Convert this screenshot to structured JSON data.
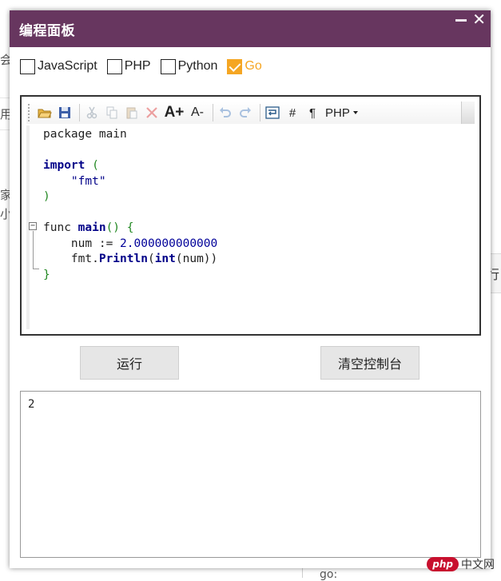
{
  "background": {
    "frag1": "会",
    "frag2": "用",
    "frag3": "家",
    "frag4": "小",
    "frag5": "行",
    "frag6": "go:"
  },
  "dialog": {
    "title": "编程面板"
  },
  "languages": [
    {
      "label": "JavaScript",
      "checked": false
    },
    {
      "label": "PHP",
      "checked": false
    },
    {
      "label": "Python",
      "checked": false
    },
    {
      "label": "Go",
      "checked": true
    }
  ],
  "editor": {
    "toolbar": {
      "icons": [
        "open-folder-icon",
        "save-icon",
        "cut-icon",
        "copy-icon",
        "paste-icon",
        "delete-icon",
        "font-increase-icon",
        "font-decrease-icon",
        "undo-icon",
        "redo-icon",
        "word-wrap-icon",
        "line-numbers-icon",
        "pilcrow-icon"
      ],
      "line_numbers_glyph": "#",
      "pilcrow_glyph": "¶",
      "font_up": "A+",
      "font_down": "A-",
      "language": "PHP"
    },
    "code": [
      "package main",
      "",
      "import (",
      "    \"fmt\"",
      ")",
      "",
      "func main() {",
      "    num := 2.000000000000",
      "    fmt.Println(int(num))",
      "}"
    ]
  },
  "buttons": {
    "run": "运行",
    "clear": "清空控制台"
  },
  "console": {
    "output": "2"
  },
  "watermark": {
    "logo": "php",
    "site": "中文网"
  },
  "colors": {
    "titlebar": "#67365f",
    "accent": "#f5a623"
  }
}
